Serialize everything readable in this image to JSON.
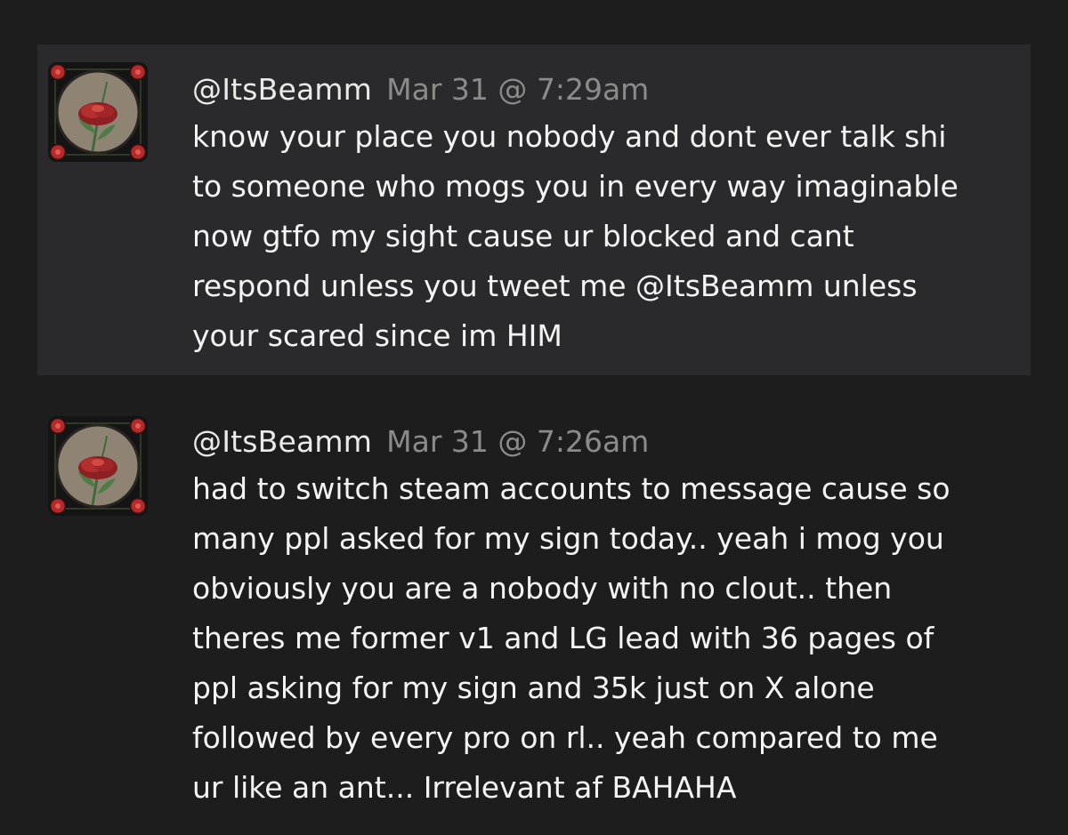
{
  "comments": [
    {
      "author": "@ItsBeamm",
      "timestamp": "Mar 31 @ 7:29am",
      "text_lines": [
        "know your place you nobody and dont ever talk shi",
        "to someone who mogs you in every way imaginable",
        "now gtfo my sight cause ur blocked and cant",
        "respond unless you tweet me @ItsBeamm unless",
        "your scared since im HIM"
      ],
      "avatar_icon": "rose-avatar-icon"
    },
    {
      "author": "@ItsBeamm",
      "timestamp": "Mar 31 @ 7:26am",
      "text_lines": [
        "had to switch steam accounts to message cause so",
        "many ppl asked for my sign today.. yeah i mog you",
        "obviously you are a nobody with no clout.. then",
        "theres me former v1 and LG lead with 36 pages of",
        "ppl asking for my sign and 35k just on X alone",
        "followed by every pro on rl.. yeah compared to me",
        "ur like an ant... Irrelevant af BAHAHA"
      ],
      "avatar_icon": "rose-avatar-icon"
    }
  ],
  "colors": {
    "background": "#1d1d1e",
    "highlighted_comment_bg": "#2a2a2c",
    "author": "#eaeaea",
    "timestamp": "#8b8b8b",
    "text": "#f4f4f4"
  }
}
